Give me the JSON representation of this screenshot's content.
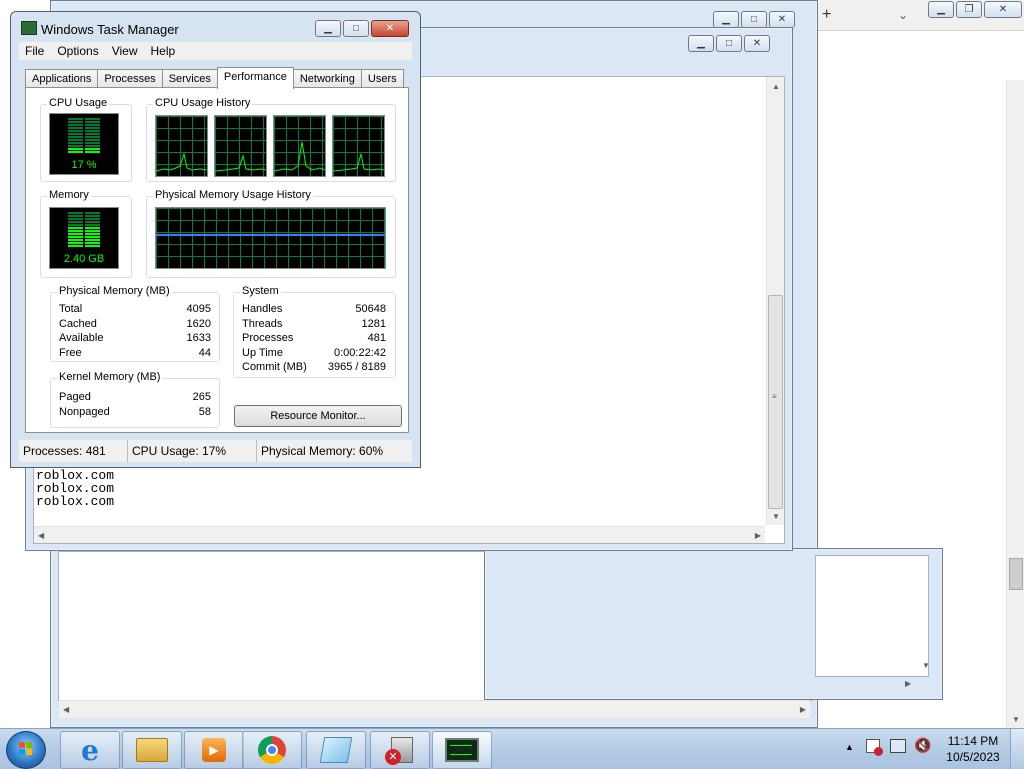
{
  "taskmgr": {
    "title": "Windows Task Manager",
    "menu": [
      "File",
      "Options",
      "View",
      "Help"
    ],
    "tabs": [
      "Applications",
      "Processes",
      "Services",
      "Performance",
      "Networking",
      "Users"
    ],
    "active_tab": "Performance",
    "cpu": {
      "label": "CPU Usage",
      "value": "17 %",
      "history_label": "CPU Usage History",
      "level": 0.17
    },
    "memory": {
      "label": "Memory",
      "value": "2.40 GB",
      "history_label": "Physical Memory Usage History",
      "level": 0.6
    },
    "physical_memory": {
      "label": "Physical Memory (MB)",
      "rows": [
        {
          "k": "Total",
          "v": "4095"
        },
        {
          "k": "Cached",
          "v": "1620"
        },
        {
          "k": "Available",
          "v": "1633"
        },
        {
          "k": "Free",
          "v": "44"
        }
      ]
    },
    "kernel_memory": {
      "label": "Kernel Memory (MB)",
      "rows": [
        {
          "k": "Paged",
          "v": "265"
        },
        {
          "k": "Nonpaged",
          "v": "58"
        }
      ]
    },
    "system": {
      "label": "System",
      "rows": [
        {
          "k": "Handles",
          "v": "50648"
        },
        {
          "k": "Threads",
          "v": "1281"
        },
        {
          "k": "Processes",
          "v": "481"
        },
        {
          "k": "Up Time",
          "v": "0:00:22:42"
        },
        {
          "k": "Commit (MB)",
          "v": "3965 / 8189"
        }
      ]
    },
    "resource_monitor_button": "Resource Monitor...",
    "status": {
      "processes": "Processes: 481",
      "cpu": "CPU Usage: 17%",
      "memory": "Physical Memory: 60%"
    }
  },
  "notepad": {
    "lines": [
      "roblox.com",
      "roblox.com",
      "roblox.com"
    ]
  },
  "taskbar": {
    "start_icon": "windows-orb-icon",
    "items": [
      {
        "name": "internet-explorer-icon"
      },
      {
        "name": "file-explorer-icon"
      },
      {
        "name": "media-player-icon"
      },
      {
        "name": "chrome-icon"
      },
      {
        "name": "notepad-icon"
      },
      {
        "name": "error-app-icon"
      },
      {
        "name": "task-manager-icon"
      }
    ],
    "time": "11:14 PM",
    "date": "10/5/2023"
  },
  "colors": {
    "graph_green": "#00ff00",
    "graph_grid": "#008040",
    "memory_line": "#3a7dff"
  }
}
